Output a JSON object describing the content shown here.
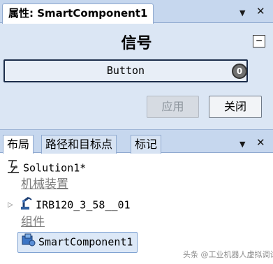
{
  "properties_panel": {
    "tab_title": "属性: SmartComponent1",
    "section_title": "信号",
    "collapse_symbol": "−",
    "signal": {
      "label": "Button",
      "state_value": "0"
    },
    "apply_label": "应用",
    "close_label": "关闭",
    "controls": {
      "dropdown": "▼",
      "close": "✕"
    }
  },
  "layout_panel": {
    "tabs": [
      {
        "label": "布局",
        "active": true
      },
      {
        "label": "路径和目标点",
        "active": false
      },
      {
        "label": "标记",
        "active": false
      }
    ],
    "controls": {
      "dropdown": "▼",
      "close": "✕"
    },
    "tree": {
      "root": "Solution1*",
      "mechanisms_heading": "机械装置",
      "robot": "IRB120_3_58__01",
      "components_heading": "组件",
      "component": "SmartComponent1"
    }
  },
  "watermark": "头条 @工业机器人虚拟调试",
  "icons": [
    "solution-icon",
    "robot-icon",
    "smart-component-icon",
    "expand-arrow-icon",
    "dropdown-icon",
    "close-icon"
  ],
  "colors": {
    "panel_bg": "#dbe6f4",
    "tabbar_bg": "#c6d7ee",
    "selection_bg": "#dce8f7",
    "disabled_text": "#8c949c"
  }
}
